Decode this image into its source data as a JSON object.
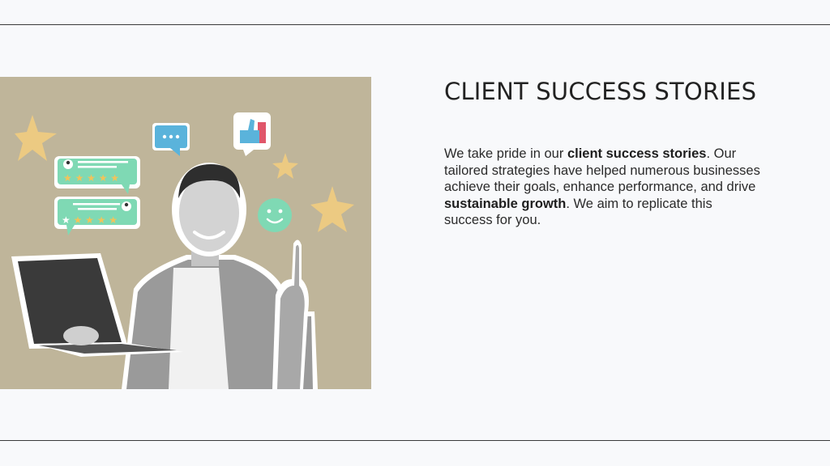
{
  "slide": {
    "title": "CLIENT SUCCESS STORIES",
    "paragraph": {
      "p1": "We take pride in our ",
      "b1": "client success stories",
      "p2": ". Our tailored strategies have helped numerous businesses achieve their goals, enhance performance, and drive ",
      "b2": "sustainable growth",
      "p3": ". We aim to replicate this success for you."
    }
  },
  "image": {
    "icons": [
      "star-icon",
      "review-card-icon",
      "chat-bubble-icon",
      "thumbs-up-icon",
      "smiley-icon",
      "laptop-icon"
    ]
  },
  "colors": {
    "background": "#f8f9fb",
    "photo_background": "#bfb59a",
    "star": "#ecca82",
    "mint": "#7fd9b4",
    "text": "#2b2b2b"
  }
}
